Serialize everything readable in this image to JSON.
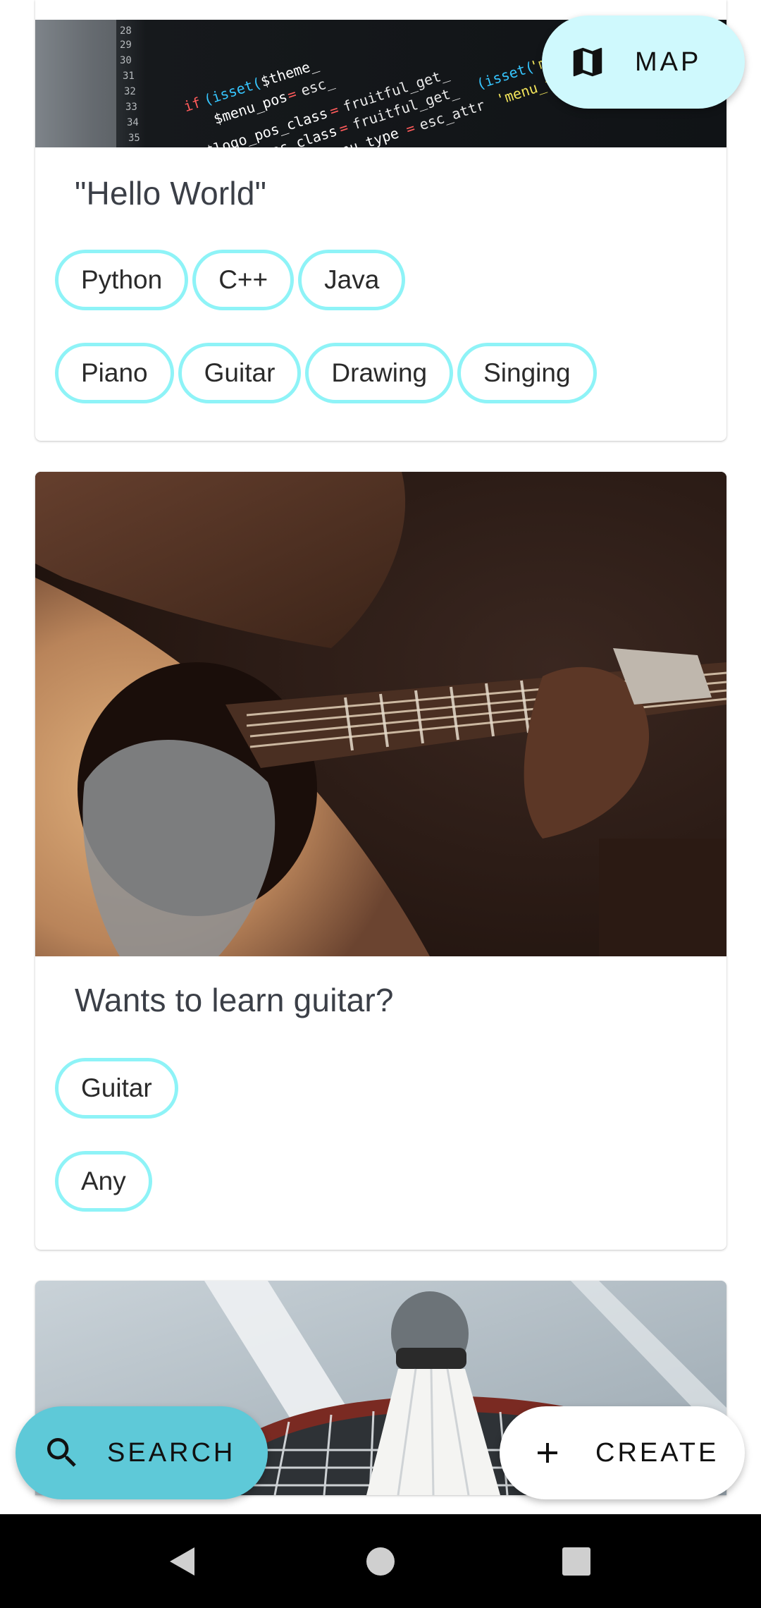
{
  "colors": {
    "chip_border": "#8ef3f7",
    "map_fab": "#cff9fd",
    "search_fab": "#5ec9d8",
    "create_fab": "#ffffff",
    "nav_bar": "#000000"
  },
  "fabs": {
    "map": {
      "label": "MAP",
      "icon": "map-icon"
    },
    "search": {
      "label": "SEARCH",
      "icon": "search-icon"
    },
    "create": {
      "label": "CREATE",
      "icon": "plus-icon"
    }
  },
  "cards": [
    {
      "image": "code-editor-photo",
      "title": "\"Hello World\"",
      "chip_rows": [
        [
          "Python",
          "C++",
          "Java"
        ],
        [
          "Piano",
          "Guitar",
          "Drawing",
          "Singing"
        ]
      ]
    },
    {
      "image": "guitar-playing-photo",
      "title": "Wants to learn guitar?",
      "chip_rows": [
        [
          "Guitar"
        ],
        [
          "Any"
        ]
      ]
    },
    {
      "image": "badminton-shuttlecock-photo"
    }
  ],
  "nav": {
    "back_icon": "back-triangle-icon",
    "home_icon": "home-circle-icon",
    "recents_icon": "recents-square-icon"
  }
}
